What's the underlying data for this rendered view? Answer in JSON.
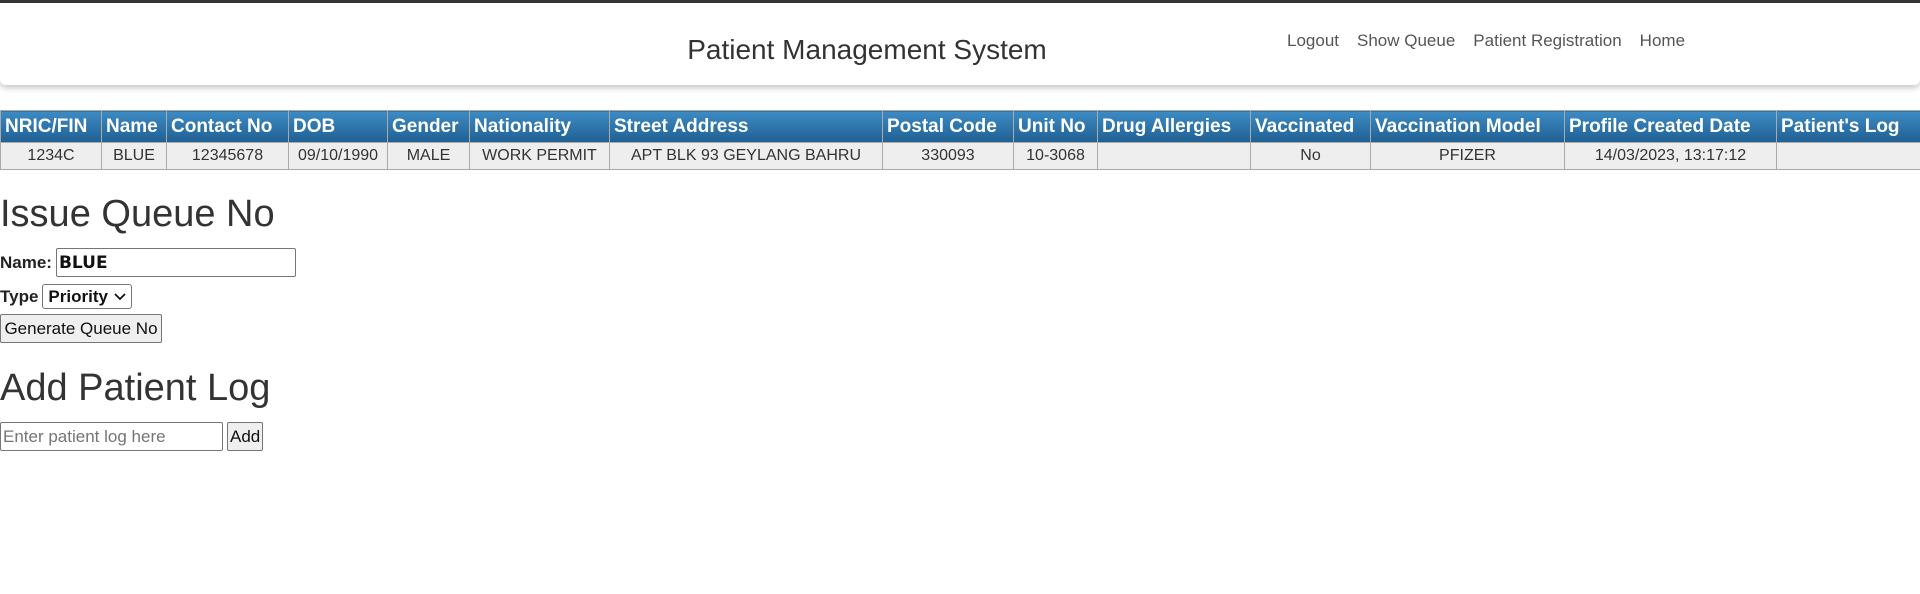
{
  "header": {
    "title": "Patient Management System",
    "nav": [
      "Logout",
      "Show Queue",
      "Patient Registration",
      "Home"
    ]
  },
  "patient_table": {
    "columns": [
      "NRIC/FIN",
      "Name",
      "Contact No",
      "DOB",
      "Gender",
      "Nationality",
      "Street Address",
      "Postal Code",
      "Unit No",
      "Drug Allergies",
      "Vaccinated",
      "Vaccination Model",
      "Profile Created Date",
      "Patient's Log"
    ],
    "rows": [
      [
        "1234C",
        "BLUE",
        "12345678",
        "09/10/1990",
        "MALE",
        "WORK PERMIT",
        "APT BLK 93 GEYLANG BAHRU",
        "330093",
        "10-3068",
        "",
        "No",
        "PFIZER",
        "14/03/2023, 13:17:12",
        ""
      ]
    ]
  },
  "issue_queue": {
    "heading": "Issue Queue No",
    "name_label": "Name:",
    "name_value": "BLUE",
    "type_label": "Type",
    "type_selected": "Priority",
    "generate_label": "Generate Queue No"
  },
  "patient_log": {
    "heading": "Add Patient Log",
    "placeholder": "Enter patient log here",
    "add_label": "Add"
  }
}
